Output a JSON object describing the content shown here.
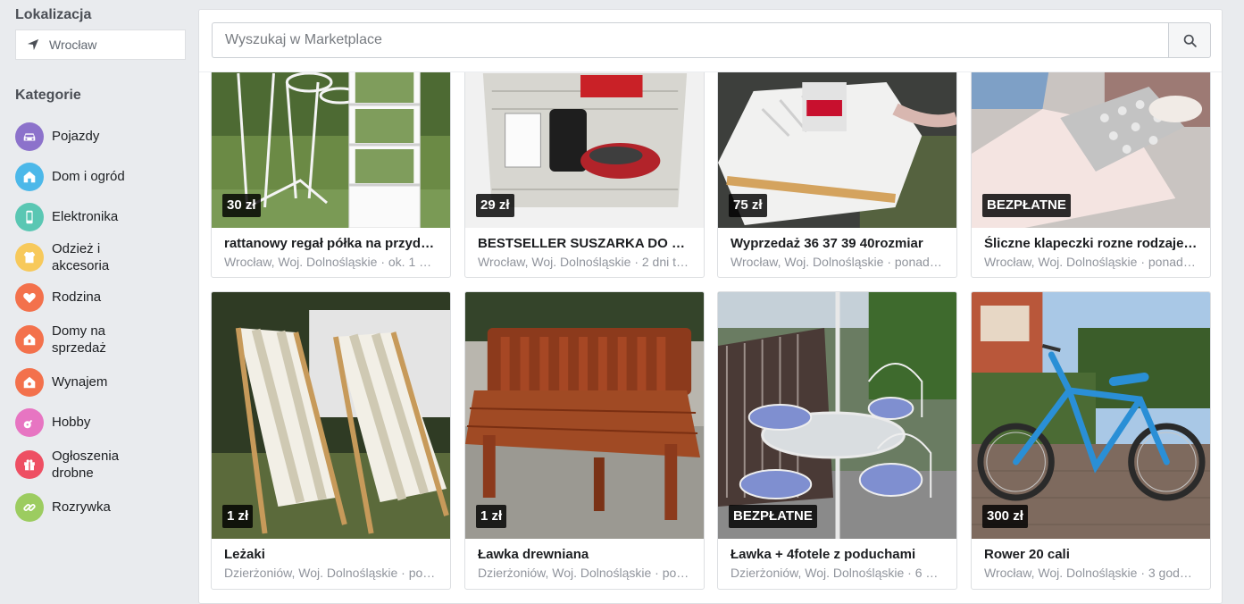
{
  "location": {
    "title": "Lokalizacja",
    "value": "Wrocław"
  },
  "categories": {
    "title": "Kategorie",
    "items": [
      {
        "label": "Pojazdy",
        "icon": "car-icon",
        "color": "#8c72cb"
      },
      {
        "label": "Dom i ogród",
        "icon": "house-icon",
        "color": "#4cb8e9"
      },
      {
        "label": "Elektronika",
        "icon": "phone-icon",
        "color": "#5ac7b3"
      },
      {
        "label": "Odzież i akcesoria",
        "icon": "shirt-icon",
        "color": "#f7c95b"
      },
      {
        "label": "Rodzina",
        "icon": "heart-icon",
        "color": "#f3714c"
      },
      {
        "label": "Domy na sprzedaż",
        "icon": "house-sale-icon",
        "color": "#f3714c"
      },
      {
        "label": "Wynajem",
        "icon": "house-rent-icon",
        "color": "#f3714c"
      },
      {
        "label": "Hobby",
        "icon": "guitar-icon",
        "color": "#e775c2"
      },
      {
        "label": "Ogłoszenia drobne",
        "icon": "gift-icon",
        "color": "#ee4f63"
      },
      {
        "label": "Rozrywka",
        "icon": "link-icon",
        "color": "#9ccc60"
      }
    ]
  },
  "search": {
    "placeholder": "Wyszukaj w Marketplace"
  },
  "listings": [
    {
      "price": "30 zł",
      "title": "rattanowy regał półka na przyda...",
      "meta": "Wrocław, Woj. Dolnośląskie · ok. 1 dz..."
    },
    {
      "price": "29 zł",
      "title": "BESTSELLER SUSZARKA DO N...",
      "meta": "Wrocław, Woj. Dolnośląskie · 2 dni temu"
    },
    {
      "price": "75 zł",
      "title": "Wyprzedaż 36 37 39 40rozmiar",
      "meta": "Wrocław, Woj. Dolnośląskie · ponad t..."
    },
    {
      "price": "BEZPŁATNE",
      "title": "Śliczne klapeczki rozne rodzaje ...",
      "meta": "Wrocław, Woj. Dolnośląskie · ponad t..."
    },
    {
      "price": "1 zł",
      "title": "Leżaki",
      "meta": "Dzierżoniów, Woj. Dolnośląskie · pon..."
    },
    {
      "price": "1 zł",
      "title": "Ławka drewniana",
      "meta": "Dzierżoniów, Woj. Dolnośląskie · pon..."
    },
    {
      "price": "BEZPŁATNE",
      "title": "Ławka + 4fotele z poduchami",
      "meta": "Dzierżoniów, Woj. Dolnośląskie · 6 dn..."
    },
    {
      "price": "300 zł",
      "title": "Rower 20 cali",
      "meta": "Wrocław, Woj. Dolnośląskie · 3 godz. ..."
    }
  ]
}
